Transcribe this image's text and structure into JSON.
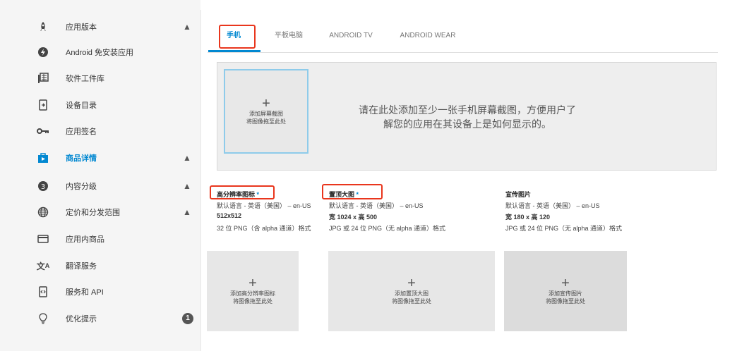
{
  "sidebar": {
    "items": [
      {
        "label": "应用版本",
        "icon": "rocket-icon",
        "warning": true
      },
      {
        "label": "Android 免安装应用",
        "icon": "instant-app-icon",
        "warning": false
      },
      {
        "label": "软件工件库",
        "icon": "library-icon",
        "warning": false
      },
      {
        "label": "设备目录",
        "icon": "device-icon",
        "warning": false
      },
      {
        "label": "应用签名",
        "icon": "key-icon",
        "warning": false
      },
      {
        "label": "商品详情",
        "icon": "store-icon",
        "warning": true,
        "active": true
      },
      {
        "label": "内容分级",
        "icon": "rating-icon",
        "warning": true
      },
      {
        "label": "定价和分发范围",
        "icon": "globe-icon",
        "warning": true
      },
      {
        "label": "应用内商品",
        "icon": "card-icon",
        "warning": false
      },
      {
        "label": "翻译服务",
        "icon": "translate-icon",
        "warning": false
      },
      {
        "label": "服务和 API",
        "icon": "api-icon",
        "warning": false
      },
      {
        "label": "优化提示",
        "icon": "lightbulb-icon",
        "badge": "1"
      }
    ]
  },
  "tabs": [
    "手机",
    "平板电脑",
    "ANDROID TV",
    "ANDROID WEAR"
  ],
  "screenshots": {
    "drop_plus": "+",
    "drop_line1": "添加屏幕截图",
    "drop_line2": "将图像拖至此处",
    "hint_line1": "请在此处添加至少一张手机屏幕截图，方便用户了",
    "hint_line2": "解您的应用在其设备上是如何显示的。"
  },
  "assets": [
    {
      "title": "高分辨率图标",
      "required": "*",
      "lang": "默认语言 - 英语（美国） – en-US",
      "size": "512x512",
      "format": "32 位 PNG（含 alpha 通道）格式",
      "drop1": "添加高分辨率图标",
      "drop2": "将图像拖至此处"
    },
    {
      "title": "置顶大图",
      "required": "*",
      "lang": "默认语言 - 英语（美国） – en-US",
      "size": "宽 1024 x 高 500",
      "format": "JPG 或 24 位 PNG（无 alpha 通道）格式",
      "drop1": "添加置顶大图",
      "drop2": "将图像拖至此处"
    },
    {
      "title": "宣传图片",
      "required": "",
      "lang": "默认语言 - 英语（美国） – en-US",
      "size": "宽 180 x 高 120",
      "format": "JPG 或 24 位 PNG（无 alpha 通道）格式",
      "drop1": "添加宣传图片",
      "drop2": "将图像拖至此处"
    }
  ],
  "colors": {
    "accent": "#0288d1",
    "highlight": "#e9361d"
  }
}
